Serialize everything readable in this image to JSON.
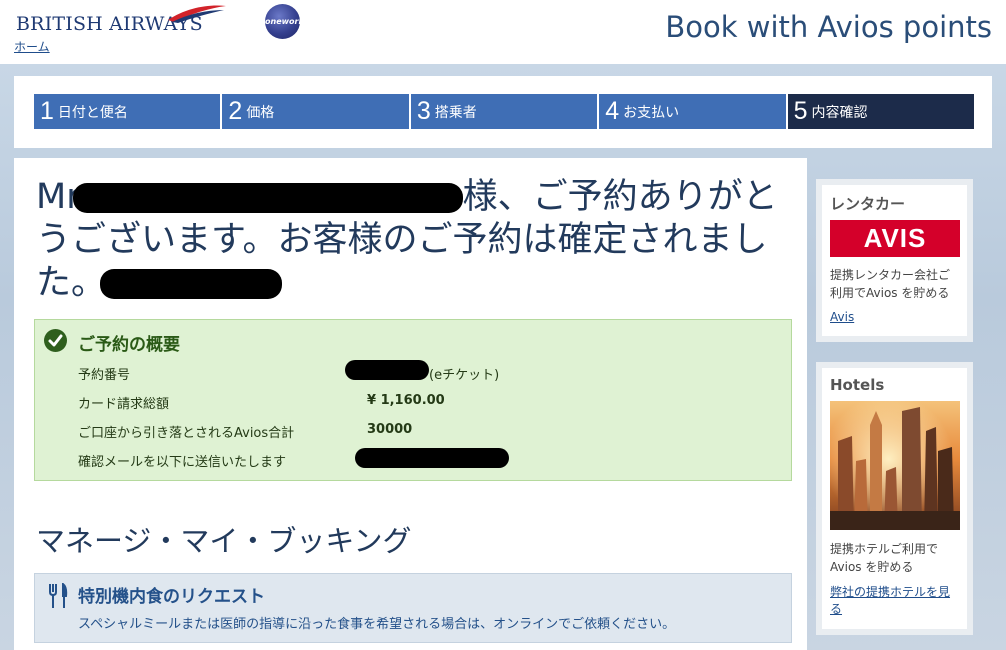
{
  "header": {
    "logo_text": "BRITISH AIRWAYS",
    "home_link": "ホーム",
    "alliance_logo": "oneworld",
    "page_title": "Book with Avios points"
  },
  "steps": [
    {
      "num": "1",
      "label": "日付と便名",
      "active": false
    },
    {
      "num": "2",
      "label": "価格",
      "active": false
    },
    {
      "num": "3",
      "label": "搭乗者",
      "active": false
    },
    {
      "num": "4",
      "label": "お支払い",
      "active": false
    },
    {
      "num": "5",
      "label": "内容確認",
      "active": true
    }
  ],
  "confirmation": {
    "prefix": "Mr",
    "line1_suffix": "様、ご予約ありがと",
    "line2": "うございます。お客様のご予約は確定されまし",
    "line3": "た。"
  },
  "summary": {
    "title": "ご予約の概要",
    "rows": [
      {
        "label": "予約番号",
        "value": "(eチケット)"
      },
      {
        "label": "カード請求総額",
        "value": "¥ 1,160.00"
      },
      {
        "label": "ご口座から引き落とされるAvios合計",
        "value": "30000"
      },
      {
        "label": "確認メールを以下に送信いたします",
        "value": ""
      }
    ]
  },
  "manage_booking": {
    "title": "マネージ・マイ・ブッキング",
    "meal_title": "特別機内食のリクエスト",
    "meal_desc": "スペシャルミールまたは医師の指導に沿った食事を希望される場合は、オンラインでご依頼ください。"
  },
  "sidebar": {
    "car": {
      "title": "レンタカー",
      "logo": "AVIS",
      "desc": "提携レンタカー会社ご利用でAvios を貯める",
      "link": "Avis"
    },
    "hotels": {
      "title": "Hotels",
      "desc": "提携ホテルご利用でAvios を貯める",
      "link": "弊社の提携ホテルを見る"
    }
  },
  "colors": {
    "brand_navy": "#1f3a73",
    "step_blue": "#3f6eb5",
    "step_active": "#1c2b4a",
    "success_bg": "#dff2d3",
    "avis_red": "#d4002a"
  }
}
